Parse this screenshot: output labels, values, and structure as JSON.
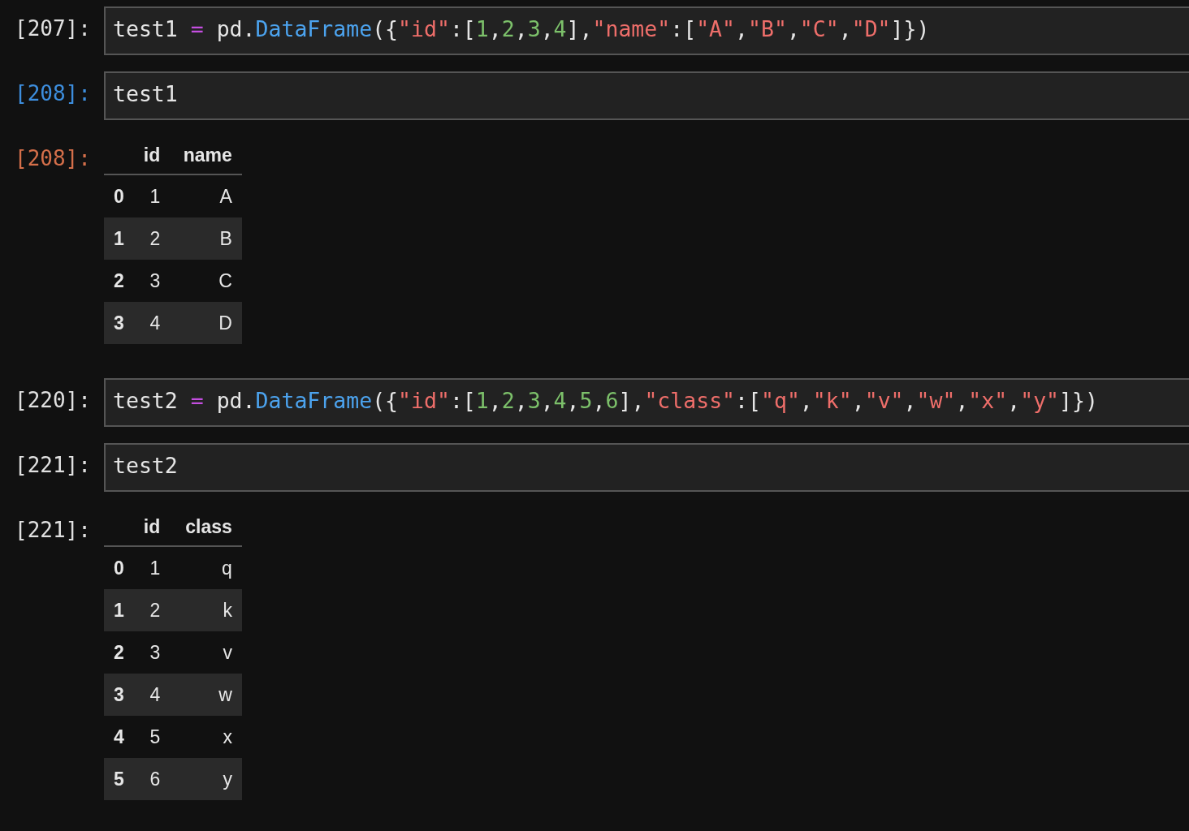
{
  "cells": [
    {
      "kind": "code",
      "prompt": "[207]:",
      "selected": false,
      "tokens": [
        {
          "kind": "plain",
          "text": "test1 "
        },
        {
          "kind": "operator",
          "text": "="
        },
        {
          "kind": "plain",
          "text": " pd."
        },
        {
          "kind": "function",
          "text": "DataFrame"
        },
        {
          "kind": "plain",
          "text": "({"
        },
        {
          "kind": "string",
          "text": "\"id\""
        },
        {
          "kind": "plain",
          "text": ":["
        },
        {
          "kind": "number",
          "text": "1"
        },
        {
          "kind": "plain",
          "text": ","
        },
        {
          "kind": "number",
          "text": "2"
        },
        {
          "kind": "plain",
          "text": ","
        },
        {
          "kind": "number",
          "text": "3"
        },
        {
          "kind": "plain",
          "text": ","
        },
        {
          "kind": "number",
          "text": "4"
        },
        {
          "kind": "plain",
          "text": "],"
        },
        {
          "kind": "string",
          "text": "\"name\""
        },
        {
          "kind": "plain",
          "text": ":["
        },
        {
          "kind": "string",
          "text": "\"A\""
        },
        {
          "kind": "plain",
          "text": ","
        },
        {
          "kind": "string",
          "text": "\"B\""
        },
        {
          "kind": "plain",
          "text": ","
        },
        {
          "kind": "string",
          "text": "\"C\""
        },
        {
          "kind": "plain",
          "text": ","
        },
        {
          "kind": "string",
          "text": "\"D\""
        },
        {
          "kind": "plain",
          "text": "]})"
        }
      ]
    },
    {
      "kind": "code",
      "prompt": "[208]:",
      "selected": true,
      "tokens": [
        {
          "kind": "plain",
          "text": "test1"
        }
      ]
    },
    {
      "kind": "output",
      "prompt": "[208]:",
      "selected": true,
      "table": {
        "columns": [
          "id",
          "name"
        ],
        "rows": [
          {
            "index": "0",
            "cells": [
              "1",
              "A"
            ]
          },
          {
            "index": "1",
            "cells": [
              "2",
              "B"
            ]
          },
          {
            "index": "2",
            "cells": [
              "3",
              "C"
            ]
          },
          {
            "index": "3",
            "cells": [
              "4",
              "D"
            ]
          }
        ]
      }
    },
    {
      "kind": "code",
      "prompt": "[220]:",
      "selected": false,
      "tokens": [
        {
          "kind": "plain",
          "text": "test2 "
        },
        {
          "kind": "operator",
          "text": "="
        },
        {
          "kind": "plain",
          "text": " pd."
        },
        {
          "kind": "function",
          "text": "DataFrame"
        },
        {
          "kind": "plain",
          "text": "({"
        },
        {
          "kind": "string",
          "text": "\"id\""
        },
        {
          "kind": "plain",
          "text": ":["
        },
        {
          "kind": "number",
          "text": "1"
        },
        {
          "kind": "plain",
          "text": ","
        },
        {
          "kind": "number",
          "text": "2"
        },
        {
          "kind": "plain",
          "text": ","
        },
        {
          "kind": "number",
          "text": "3"
        },
        {
          "kind": "plain",
          "text": ","
        },
        {
          "kind": "number",
          "text": "4"
        },
        {
          "kind": "plain",
          "text": ","
        },
        {
          "kind": "number",
          "text": "5"
        },
        {
          "kind": "plain",
          "text": ","
        },
        {
          "kind": "number",
          "text": "6"
        },
        {
          "kind": "plain",
          "text": "],"
        },
        {
          "kind": "string",
          "text": "\"class\""
        },
        {
          "kind": "plain",
          "text": ":["
        },
        {
          "kind": "string",
          "text": "\"q\""
        },
        {
          "kind": "plain",
          "text": ","
        },
        {
          "kind": "string",
          "text": "\"k\""
        },
        {
          "kind": "plain",
          "text": ","
        },
        {
          "kind": "string",
          "text": "\"v\""
        },
        {
          "kind": "plain",
          "text": ","
        },
        {
          "kind": "string",
          "text": "\"w\""
        },
        {
          "kind": "plain",
          "text": ","
        },
        {
          "kind": "string",
          "text": "\"x\""
        },
        {
          "kind": "plain",
          "text": ","
        },
        {
          "kind": "string",
          "text": "\"y\""
        },
        {
          "kind": "plain",
          "text": "]})"
        }
      ]
    },
    {
      "kind": "code",
      "prompt": "[221]:",
      "selected": false,
      "tokens": [
        {
          "kind": "plain",
          "text": "test2"
        }
      ]
    },
    {
      "kind": "output",
      "prompt": "[221]:",
      "selected": false,
      "table": {
        "columns": [
          "id",
          "class"
        ],
        "rows": [
          {
            "index": "0",
            "cells": [
              "1",
              "q"
            ]
          },
          {
            "index": "1",
            "cells": [
              "2",
              "k"
            ]
          },
          {
            "index": "2",
            "cells": [
              "3",
              "v"
            ]
          },
          {
            "index": "3",
            "cells": [
              "4",
              "w"
            ]
          },
          {
            "index": "4",
            "cells": [
              "5",
              "x"
            ]
          },
          {
            "index": "5",
            "cells": [
              "6",
              "y"
            ]
          }
        ]
      }
    }
  ]
}
